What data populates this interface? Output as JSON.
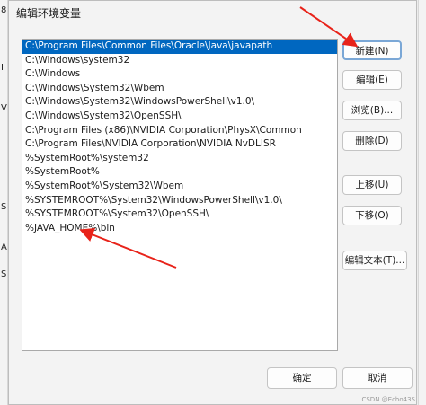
{
  "dialog": {
    "title": "编辑环境变量"
  },
  "paths": [
    "C:\\Program Files\\Common Files\\Oracle\\Java\\javapath",
    "C:\\Windows\\system32",
    "C:\\Windows",
    "C:\\Windows\\System32\\Wbem",
    "C:\\Windows\\System32\\WindowsPowerShell\\v1.0\\",
    "C:\\Windows\\System32\\OpenSSH\\",
    "C:\\Program Files (x86)\\NVIDIA Corporation\\PhysX\\Common",
    "C:\\Program Files\\NVIDIA Corporation\\NVIDIA NvDLISR",
    "%SystemRoot%\\system32",
    "%SystemRoot%",
    "%SystemRoot%\\System32\\Wbem",
    "%SYSTEMROOT%\\System32\\WindowsPowerShell\\v1.0\\",
    "%SYSTEMROOT%\\System32\\OpenSSH\\",
    "%JAVA_HOME%\\bin"
  ],
  "buttons": {
    "new": "新建(N)",
    "edit": "编辑(E)",
    "browse": "浏览(B)...",
    "delete": "删除(D)",
    "move_up": "上移(U)",
    "move_down": "下移(O)",
    "edit_text": "编辑文本(T)...",
    "ok": "确定",
    "cancel": "取消"
  },
  "watermark": "CSDN @Echo43S",
  "annotation_color": "#e8231a",
  "selection_color": "#0067c0"
}
